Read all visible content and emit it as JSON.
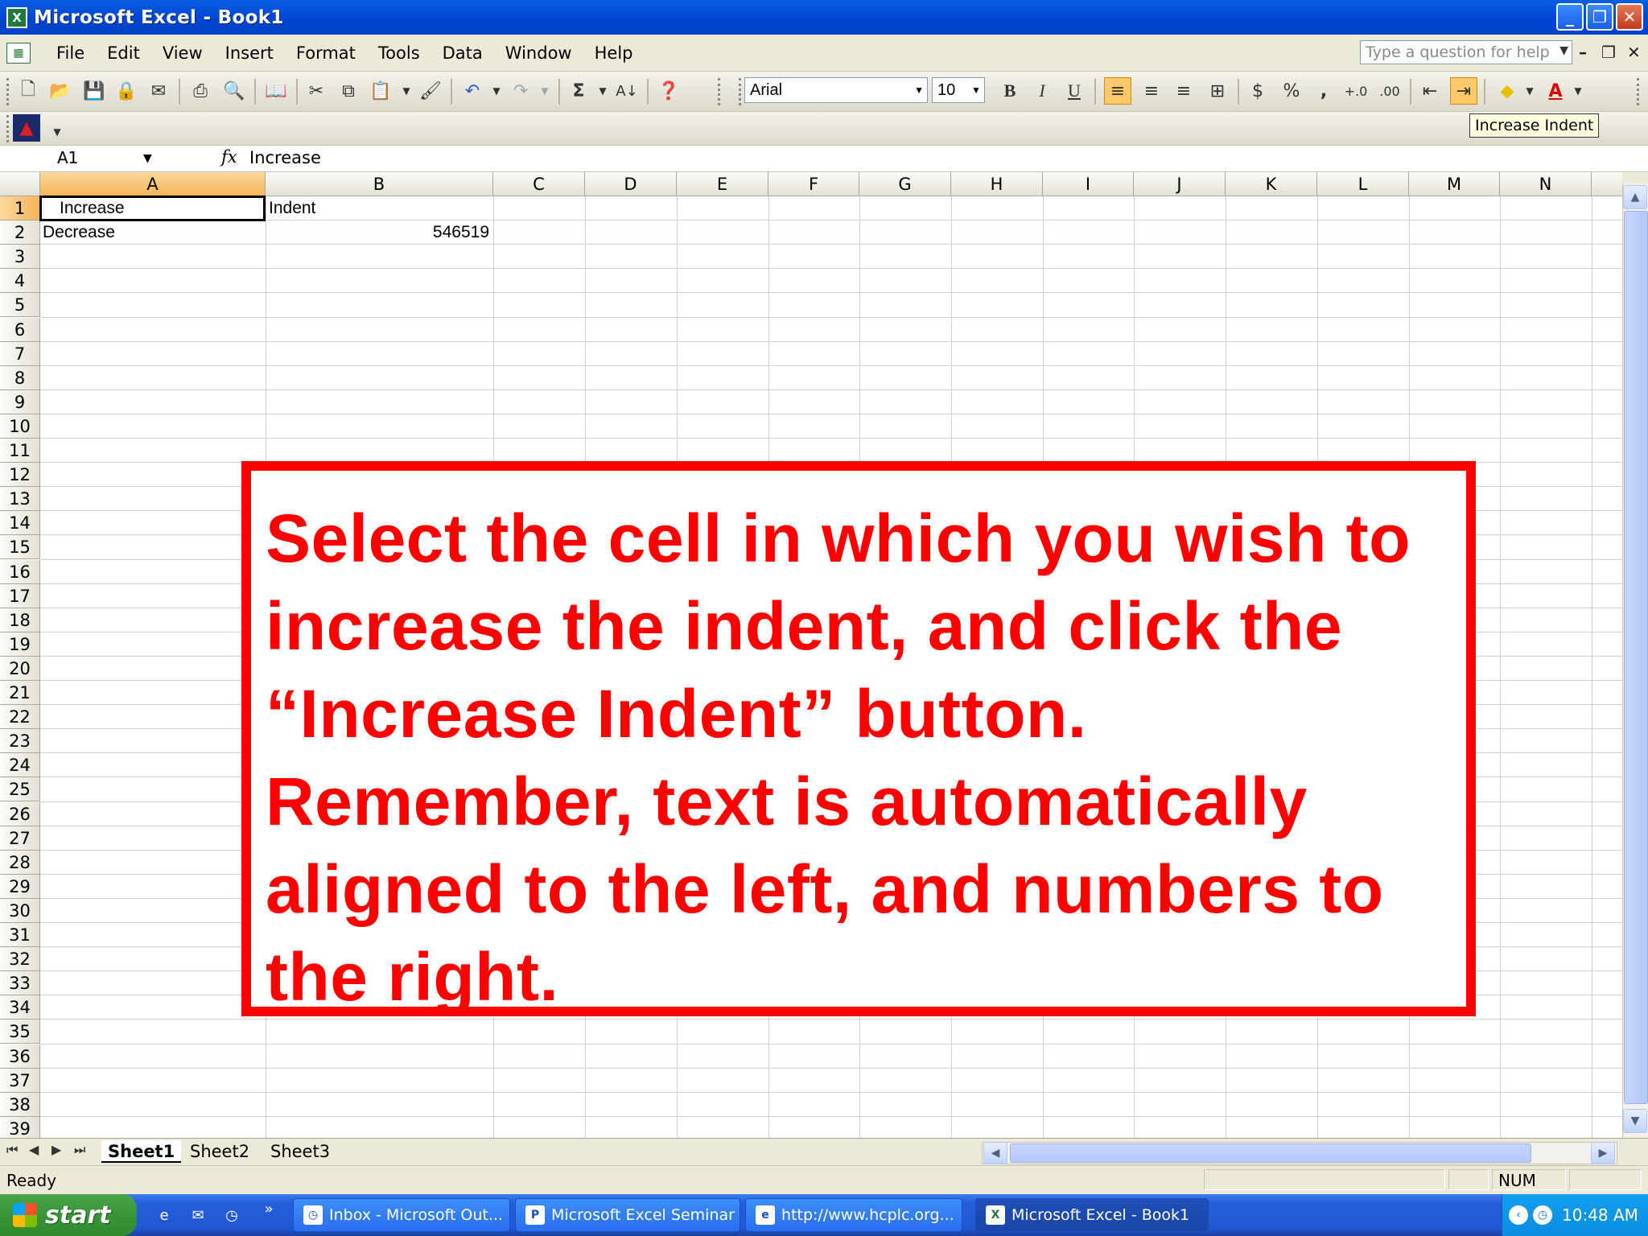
{
  "window": {
    "title": "Microsoft Excel - Book1",
    "app_icon": "excel-icon",
    "minimize_label": "_",
    "restore_label": "❐",
    "close_label": "✕"
  },
  "menu": {
    "items": [
      "File",
      "Edit",
      "View",
      "Insert",
      "Format",
      "Tools",
      "Data",
      "Window",
      "Help"
    ],
    "help_placeholder": "Type a question for help"
  },
  "toolbar": {
    "font_name": "Arial",
    "font_size": "10",
    "bold_label": "B",
    "italic_label": "I",
    "underline_label": "U",
    "currency_label": "$",
    "percent_label": "%",
    "comma_label": ",",
    "tooltip": "Increase Indent"
  },
  "formula_bar": {
    "name_box": "A1",
    "fx_label": "fx",
    "value": "Increase"
  },
  "grid": {
    "columns": [
      "A",
      "B",
      "C",
      "D",
      "E",
      "F",
      "G",
      "H",
      "I",
      "J",
      "K",
      "L",
      "M",
      "N"
    ],
    "rows": [
      "1",
      "2",
      "3",
      "4",
      "5",
      "6",
      "7",
      "8",
      "9",
      "10",
      "11",
      "12",
      "13",
      "14",
      "15",
      "16",
      "17",
      "18",
      "19",
      "20",
      "21",
      "22",
      "23",
      "24",
      "25",
      "26",
      "27",
      "28",
      "29",
      "30",
      "31",
      "32",
      "33",
      "34",
      "35",
      "36",
      "37",
      "38",
      "39"
    ],
    "cells": {
      "A1": "Increase",
      "B1": "Indent",
      "A2": "Decrease",
      "B2": "546519"
    },
    "selected_cell": "A1"
  },
  "sheets": {
    "tabs": [
      "Sheet1",
      "Sheet2",
      "Sheet3"
    ],
    "active": "Sheet1"
  },
  "status": {
    "text": "Ready",
    "num_indicator": "NUM"
  },
  "taskbar": {
    "start_label": "start",
    "tasks": [
      "Inbox - Microsoft Out...",
      "Microsoft Excel Seminar",
      "http://www.hcplc.org...",
      "Microsoft Excel - Book1"
    ],
    "active_task": "Microsoft Excel - Book1",
    "clock": "10:48 AM"
  },
  "callout": {
    "text": "Select the cell in which you wish to increase the indent, and click the “Increase Indent” button. Remember, text is automatically aligned to the left, and numbers to the right.",
    "color": "#ff0000"
  }
}
